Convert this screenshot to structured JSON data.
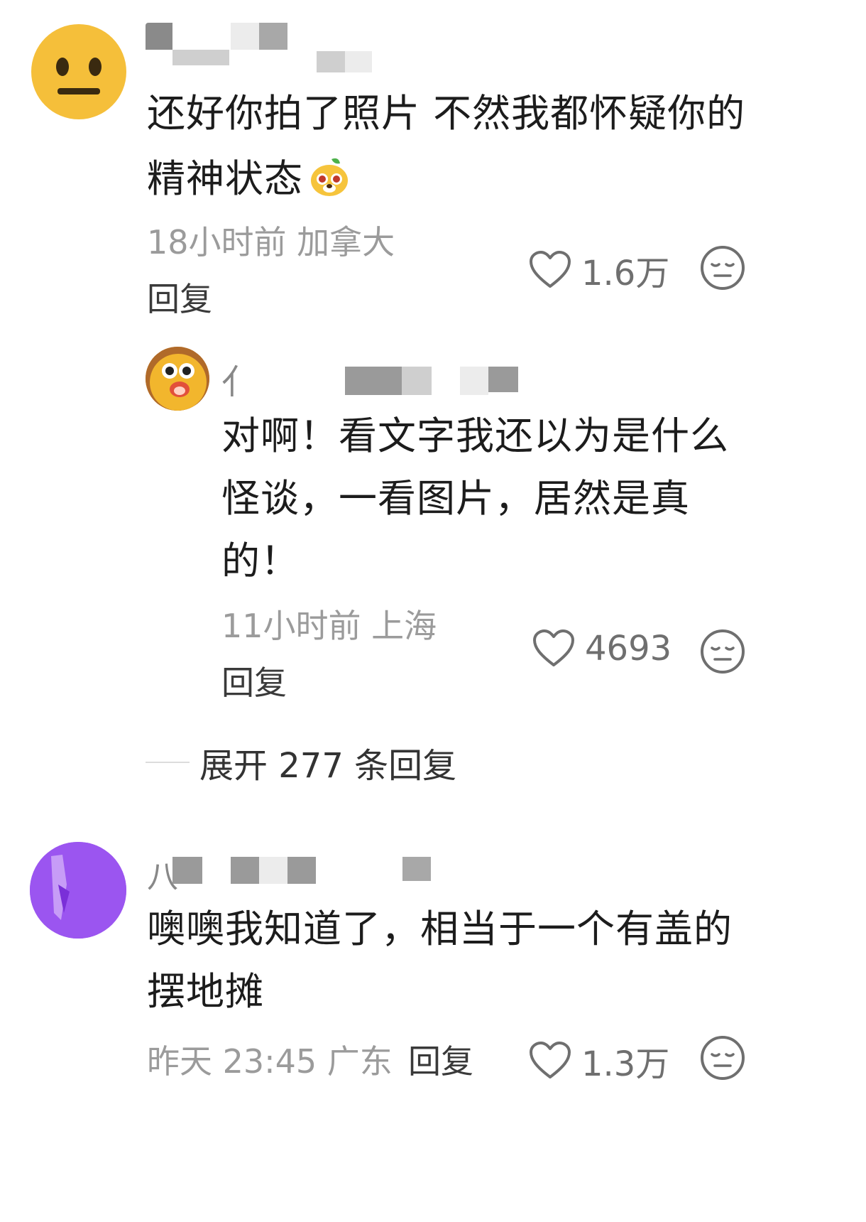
{
  "comments": [
    {
      "text": "还好你拍了照片 不然我都怀疑你的精神状态",
      "emoji_icon": "cartoon-dog-emoji-icon",
      "meta": "18小时前 加拿大",
      "reply_label": "回复",
      "likes": "1.6万"
    },
    {
      "name_glyph": "亻",
      "text": "对啊！看文字我还以为是什么怪谈，一看图片，居然是真的！",
      "meta": "11小时前 上海",
      "reply_label": "回复",
      "likes": "4693"
    },
    {
      "name_glyph": "八",
      "text": "噢噢我知道了，相当于一个有盖的摆地摊",
      "meta": "昨天 23:45 广东",
      "reply_label": "回复",
      "likes": "1.3万"
    }
  ],
  "expand_replies": "展开 277 条回复",
  "colors": {
    "avatar1": "#f5bf3a",
    "avatar3": "#9b55f0",
    "meta_gray": "#9b9b9b"
  }
}
